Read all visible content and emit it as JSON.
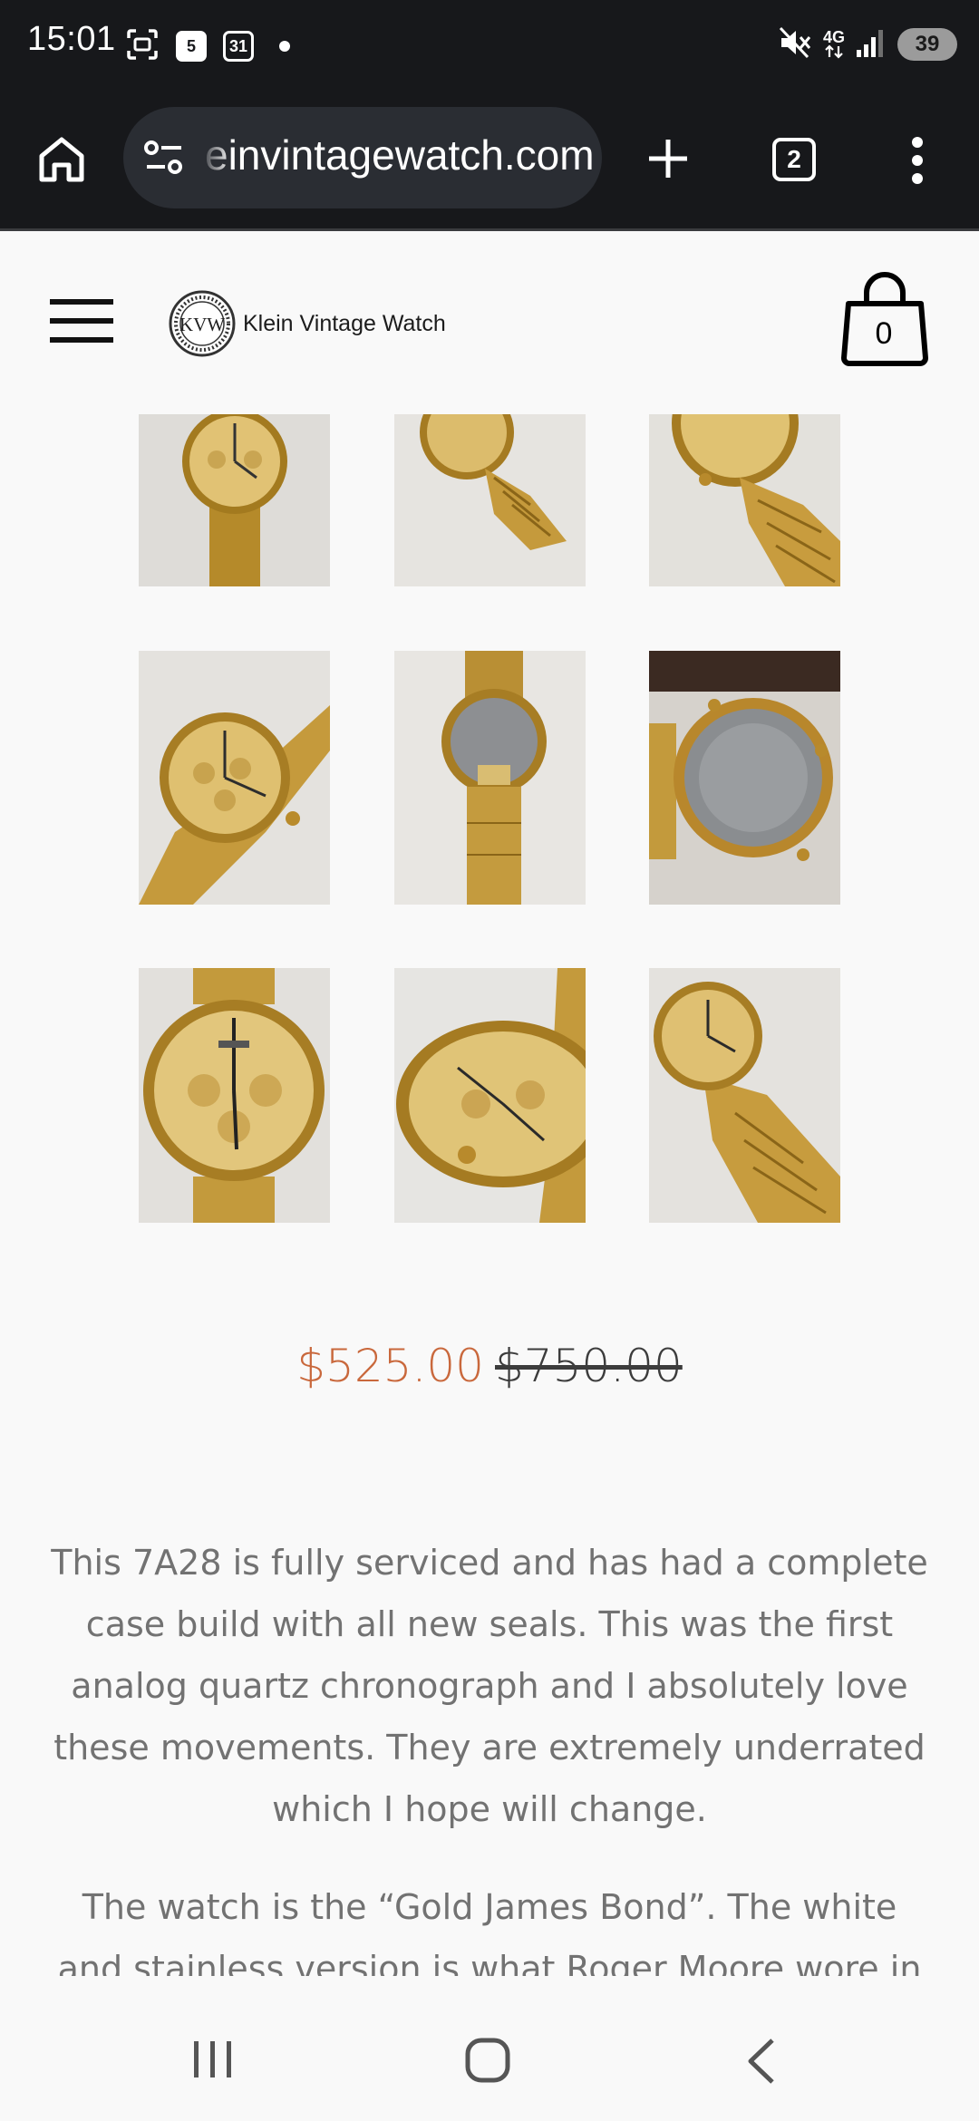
{
  "status_bar": {
    "time": "15:01",
    "calendar_day": "5",
    "calendar_date": "31",
    "battery": "39",
    "network": "4G"
  },
  "browser": {
    "url": "einvintagewatch.com",
    "tab_count": "2"
  },
  "site": {
    "brand": "Klein Vintage Watch",
    "logo_letters": "KVW",
    "cart_count": "0"
  },
  "gallery": {
    "image_count": 9
  },
  "price": {
    "sale": "$525.00",
    "original": "$750.00"
  },
  "description": {
    "p1": "This 7A28 is fully serviced and has had a complete case build with all new seals. This was the first analog quartz chronograph and I absolutely love these movements. They are extremely underrated which I hope will change.",
    "p2": "The watch is the “Gold James Bond”. The white and stainless version is what Roger Moore wore in"
  },
  "colors": {
    "sale_price": "#c9683c",
    "chrome": "#17181b",
    "url_pill": "#2a2d33",
    "page_bg": "#f9f9f9",
    "body_text": "#727272"
  },
  "icons": {
    "home": "home-icon",
    "site_settings": "tune-icon",
    "new_tab": "plus-icon",
    "menu": "more-vert-icon",
    "hamburger": "hamburger-icon",
    "cart": "shopping-bag-icon"
  }
}
